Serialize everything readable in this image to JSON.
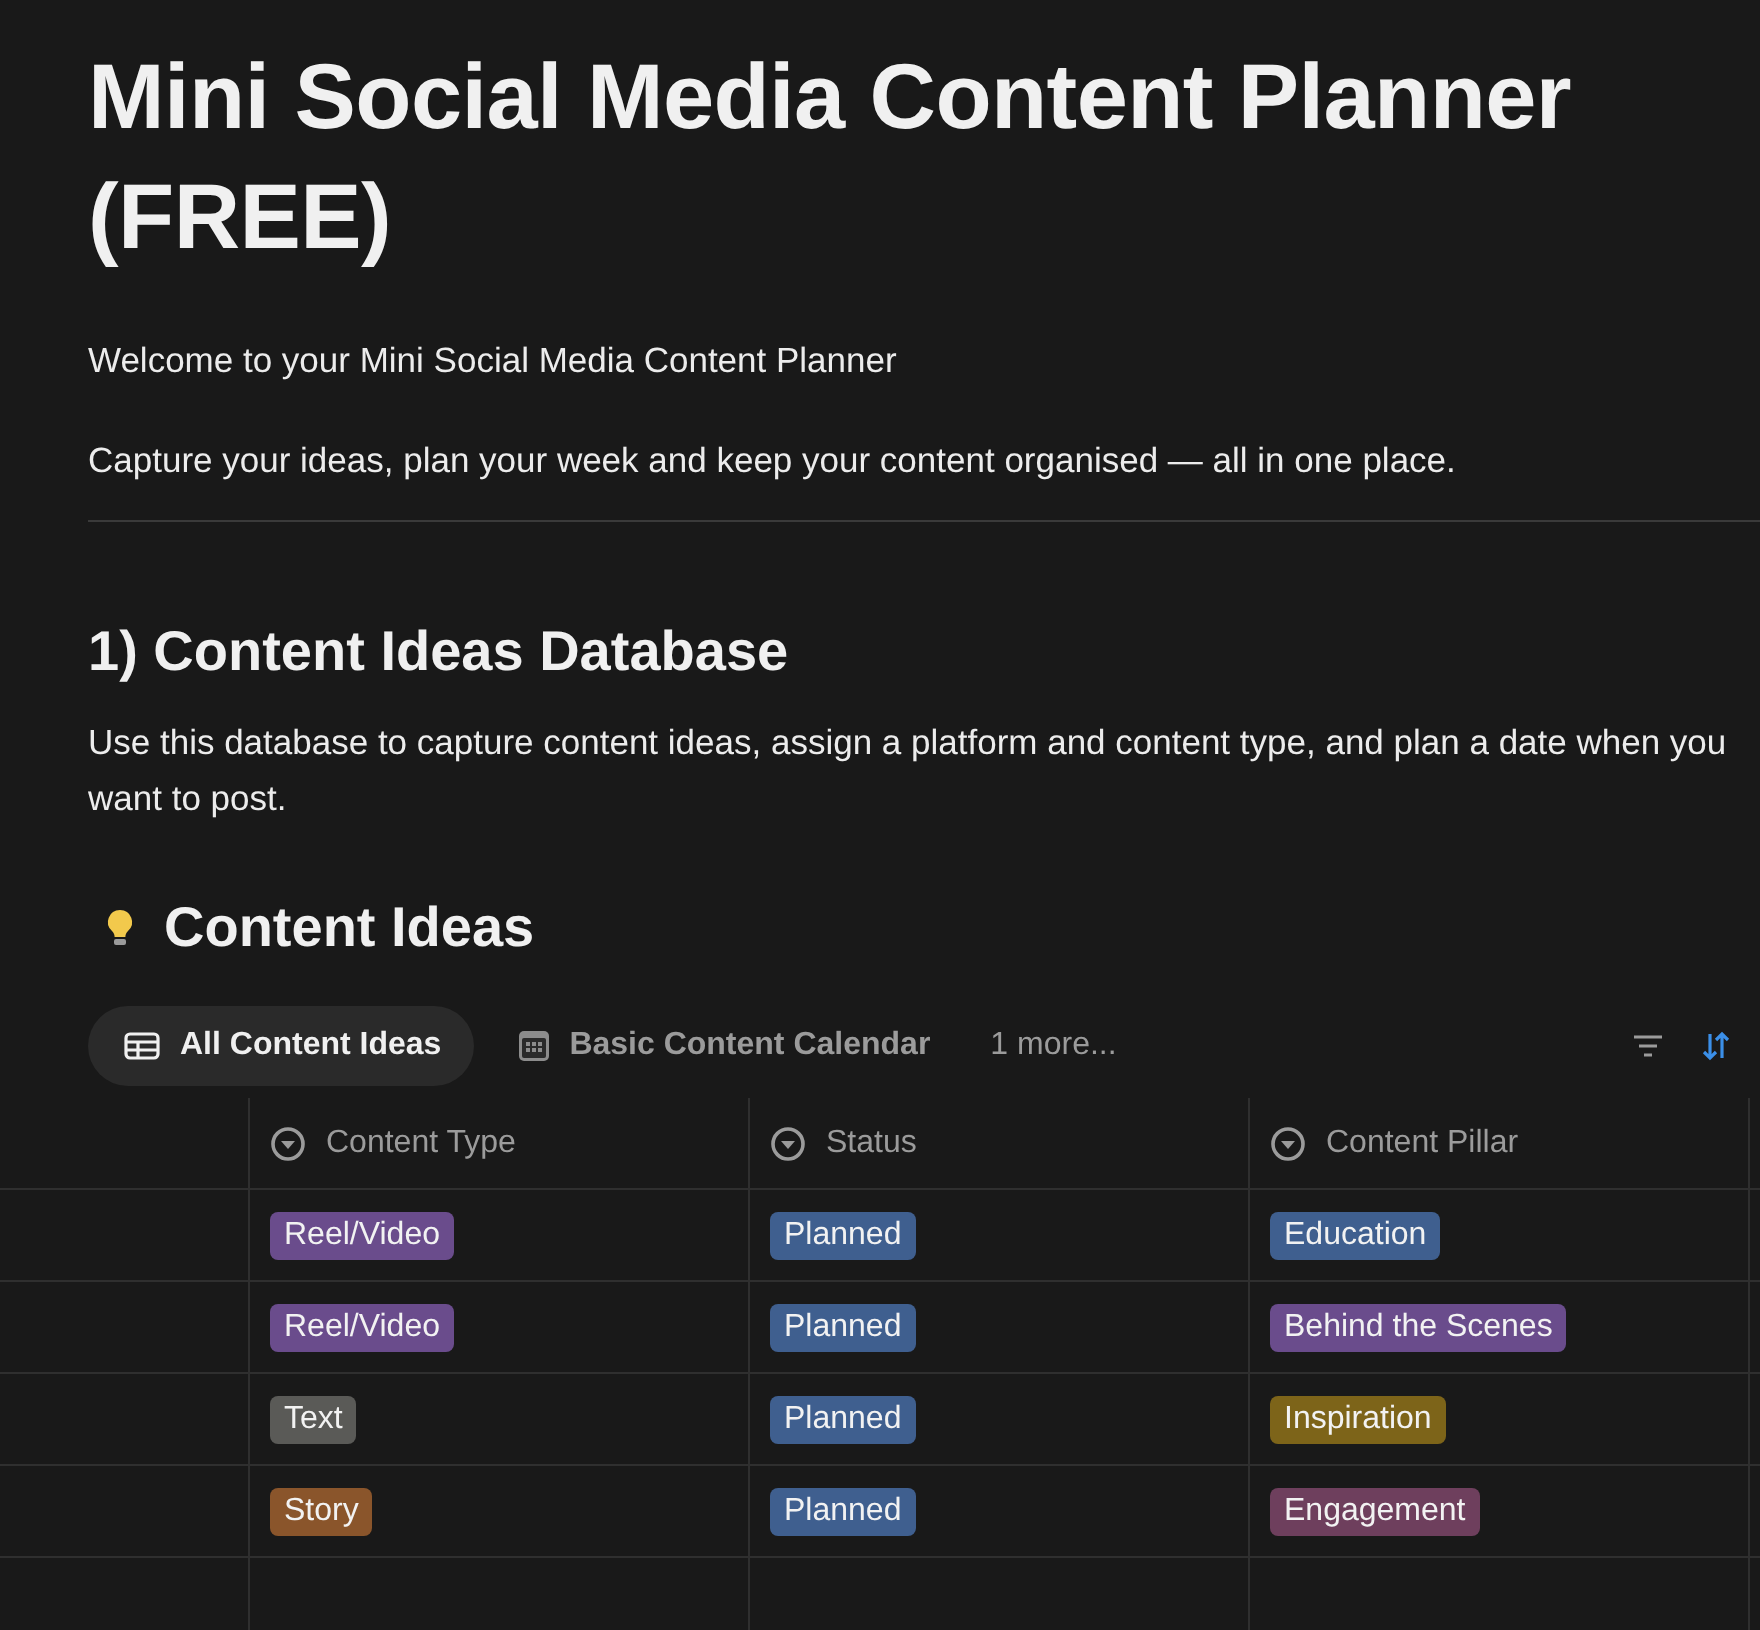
{
  "page": {
    "title": "Mini Social Media Content Planner (FREE)",
    "intro": [
      "Welcome to your Mini Social Media Content Planner",
      "Capture your ideas, plan your week and keep your content organised — all in one place."
    ]
  },
  "section": {
    "heading": "1) Content Ideas Database",
    "description": "Use this database to capture content ideas, assign a platform and content type, and plan a date when you want to post."
  },
  "database": {
    "title": "Content Ideas",
    "views": [
      {
        "label": "All Content Ideas",
        "kind": "table",
        "selected": true
      },
      {
        "label": "Basic Content Calendar",
        "kind": "calendar",
        "selected": false
      }
    ],
    "more_views": "1 more...",
    "table": {
      "columns": [
        "Content Type",
        "Status",
        "Content Pillar"
      ],
      "rows": [
        [
          {
            "label": "Reel/Video",
            "color": "#6a4c8c"
          },
          {
            "label": "Planned",
            "color": "#3f5f8f"
          },
          {
            "label": "Education",
            "color": "#3f5f8f"
          }
        ],
        [
          {
            "label": "Reel/Video",
            "color": "#6a4c8c"
          },
          {
            "label": "Planned",
            "color": "#3f5f8f"
          },
          {
            "label": "Behind the Scenes",
            "color": "#6a4c8c"
          }
        ],
        [
          {
            "label": "Text",
            "color": "#5a5a57"
          },
          {
            "label": "Planned",
            "color": "#3f5f8f"
          },
          {
            "label": "Inspiration",
            "color": "#7d6419"
          }
        ],
        [
          {
            "label": "Story",
            "color": "#8a552b"
          },
          {
            "label": "Planned",
            "color": "#3f5f8f"
          },
          {
            "label": "Engagement",
            "color": "#6e3f5d"
          }
        ]
      ]
    }
  }
}
